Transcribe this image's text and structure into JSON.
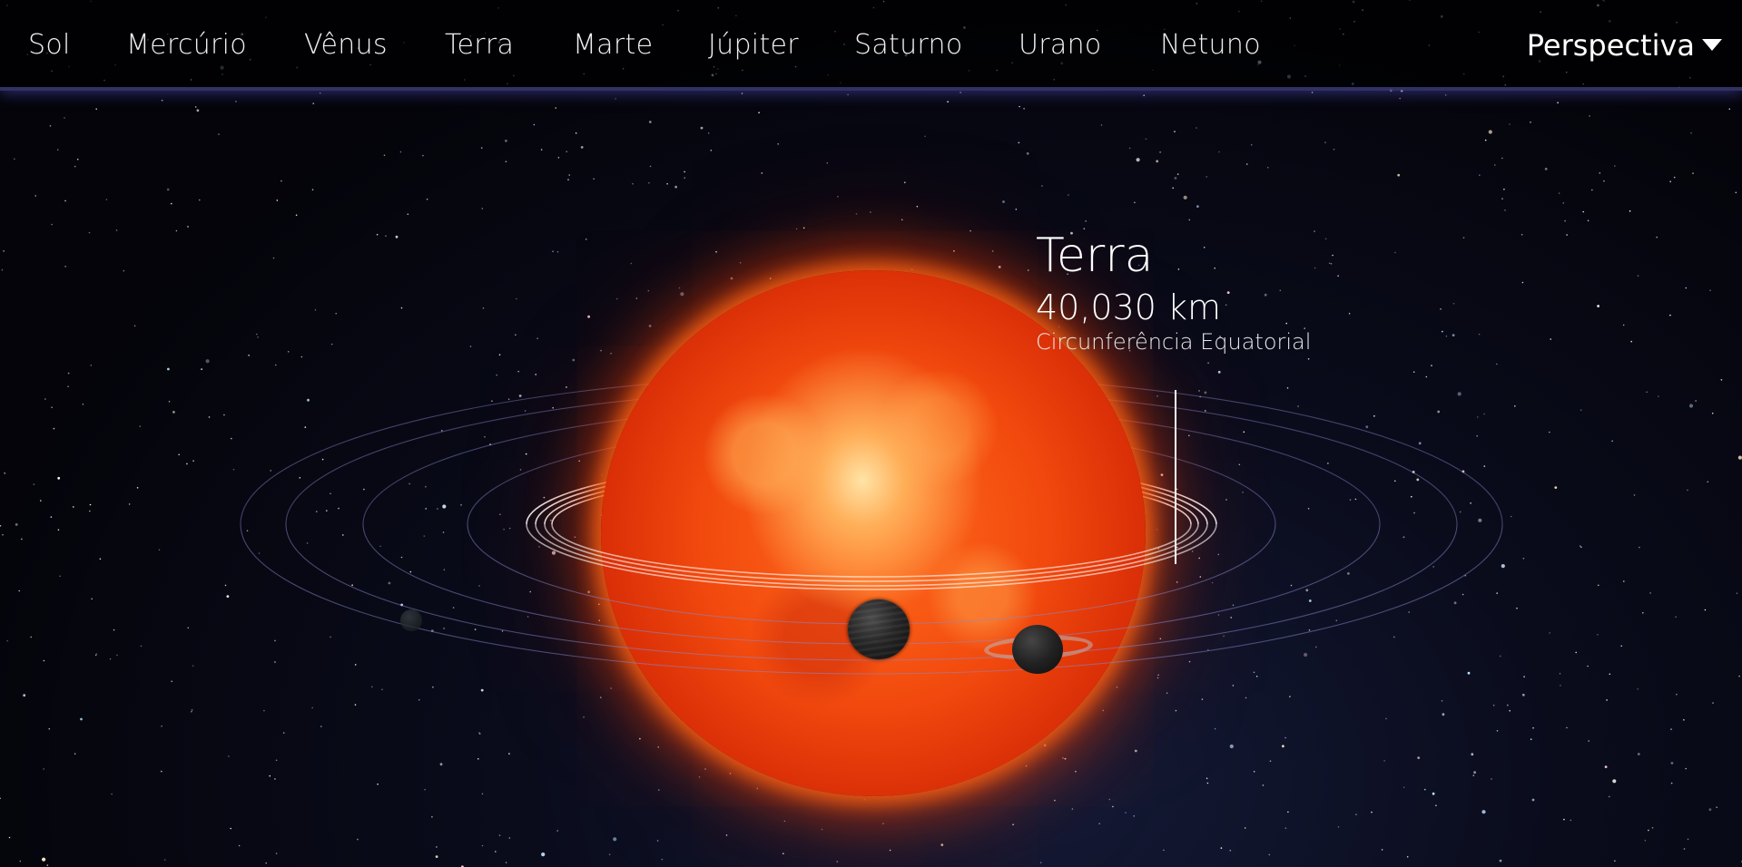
{
  "nav": {
    "items": [
      {
        "label": "Sol"
      },
      {
        "label": "Mercúrio"
      },
      {
        "label": "Vênus"
      },
      {
        "label": "Terra"
      },
      {
        "label": "Marte"
      },
      {
        "label": "Júpiter"
      },
      {
        "label": "Saturno"
      },
      {
        "label": "Urano"
      },
      {
        "label": "Netuno"
      }
    ],
    "view_selector": {
      "label": "Perspectiva"
    }
  },
  "info": {
    "planet_name": "Terra",
    "metric_value": "40,030 km",
    "metric_label": "Circunferência Equatorial"
  },
  "colors": {
    "sun_core": "#ff6a1c",
    "sun_edge": "#b51a03",
    "orbit_line": "#8a8ad0",
    "highlight_orbit": "#ffffff",
    "text": "#ffffff",
    "nav_shadow": "#5a5ab4"
  },
  "icons": {
    "view_dropdown": "caret-down-icon"
  }
}
